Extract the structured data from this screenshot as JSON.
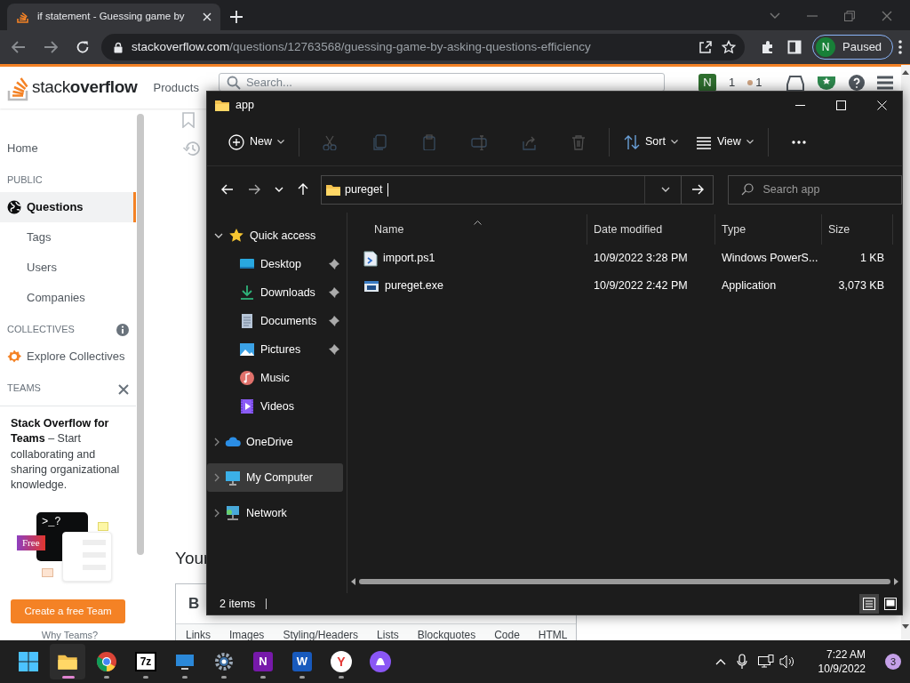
{
  "browser": {
    "tab_title": "if statement - Guessing game by",
    "url_host": "stackoverflow.com",
    "url_path": "/questions/12763568/guessing-game-by-asking-questions-efficiency",
    "profile_initial": "N",
    "profile_status": "Paused"
  },
  "site_header": {
    "logo_light": "stack",
    "logo_bold": "overflow",
    "products": "Products",
    "search_placeholder": "Search...",
    "user_initial": "N",
    "reputation": "1",
    "bronze_badges": "1"
  },
  "sidebar": {
    "items": [
      {
        "kind": "link",
        "label": "Home",
        "selected": false
      },
      {
        "kind": "heading",
        "label": "PUBLIC"
      },
      {
        "kind": "globe-link",
        "label": "Questions",
        "selected": true
      },
      {
        "kind": "sublink",
        "label": "Tags",
        "selected": false
      },
      {
        "kind": "sublink",
        "label": "Users",
        "selected": false
      },
      {
        "kind": "sublink",
        "label": "Companies",
        "selected": false
      },
      {
        "kind": "heading-info",
        "label": "COLLECTIVES"
      },
      {
        "kind": "collective-link",
        "label": "Explore Collectives",
        "selected": false
      },
      {
        "kind": "heading-close",
        "label": "TEAMS"
      }
    ]
  },
  "teams_card": {
    "text": "**Stack Overflow for Teams** – Start collaborating and sharing organizational knowledge.",
    "prompt": ">_?",
    "badge": "Free",
    "button": "Create a free Team",
    "link": "Why Teams?"
  },
  "question": {
    "answer_heading": "Your",
    "bold_button": "B",
    "editor_tabs": [
      "Links",
      "Images",
      "Styling/Headers",
      "Lists",
      "Blockquotes",
      "Code",
      "HTML"
    ]
  },
  "explorer": {
    "title": "app",
    "toolbar": [
      {
        "kind": "new",
        "label": "New",
        "disabled": false
      },
      {
        "kind": "cut",
        "disabled": true
      },
      {
        "kind": "copy",
        "disabled": true
      },
      {
        "kind": "paste",
        "disabled": true
      },
      {
        "kind": "rename",
        "disabled": true
      },
      {
        "kind": "share",
        "disabled": true
      },
      {
        "kind": "delete",
        "disabled": true
      },
      {
        "kind": "sort",
        "label": "Sort",
        "disabled": false
      },
      {
        "kind": "view",
        "label": "View",
        "disabled": false
      },
      {
        "kind": "more",
        "disabled": false
      }
    ],
    "address": "pureget",
    "search_placeholder": "Search app",
    "tree": [
      {
        "label": "Quick access",
        "kind": "star",
        "expanded": true,
        "selected": false,
        "children": [
          {
            "label": "Desktop",
            "kind": "desktop",
            "pinned": true,
            "selected": false
          },
          {
            "label": "Downloads",
            "kind": "download",
            "pinned": true,
            "selected": false
          },
          {
            "label": "Documents",
            "kind": "document",
            "pinned": true,
            "selected": false
          },
          {
            "label": "Pictures",
            "kind": "image",
            "pinned": true,
            "selected": false
          },
          {
            "label": "Music",
            "kind": "music",
            "pinned": false,
            "selected": false
          },
          {
            "label": "Videos",
            "kind": "video",
            "pinned": false,
            "selected": false
          }
        ]
      },
      {
        "label": "OneDrive",
        "kind": "cloud",
        "expanded": false,
        "selected": false
      },
      {
        "label": "My Computer",
        "kind": "computer",
        "expanded": false,
        "selected": true
      },
      {
        "label": "Network",
        "kind": "network",
        "expanded": false,
        "selected": false
      }
    ],
    "columns": [
      "Name",
      "Date modified",
      "Type",
      "Size"
    ],
    "files": [
      {
        "name": "import.ps1",
        "kind": "script",
        "date": "10/9/2022 3:28 PM",
        "type": "Windows PowerS...",
        "size": "1 KB"
      },
      {
        "name": "pureget.exe",
        "kind": "app",
        "date": "10/9/2022 2:42 PM",
        "type": "Application",
        "size": "3,073 KB"
      }
    ],
    "status": "2 items",
    "views": [
      {
        "kind": "details",
        "selected": true
      },
      {
        "kind": "tiles",
        "selected": false
      }
    ]
  },
  "taskbar": {
    "apps": [
      {
        "kind": "start",
        "running": false,
        "active": false
      },
      {
        "kind": "explorer",
        "running": true,
        "active": true
      },
      {
        "kind": "chrome",
        "running": true,
        "active": false
      },
      {
        "kind": "archiver",
        "label": "7z",
        "running": true,
        "active": false
      },
      {
        "kind": "monitor",
        "running": true,
        "active": false
      },
      {
        "kind": "settings",
        "running": true,
        "active": false
      },
      {
        "kind": "notebook",
        "label": "N",
        "running": true,
        "active": false
      },
      {
        "kind": "word",
        "label": "W",
        "running": true,
        "active": false
      },
      {
        "kind": "ybrowser",
        "label": "Y",
        "running": true,
        "active": false
      },
      {
        "kind": "assistant",
        "running": false,
        "active": false
      }
    ],
    "time": "7:22 AM",
    "date": "10/9/2022",
    "notification_count": "3"
  }
}
